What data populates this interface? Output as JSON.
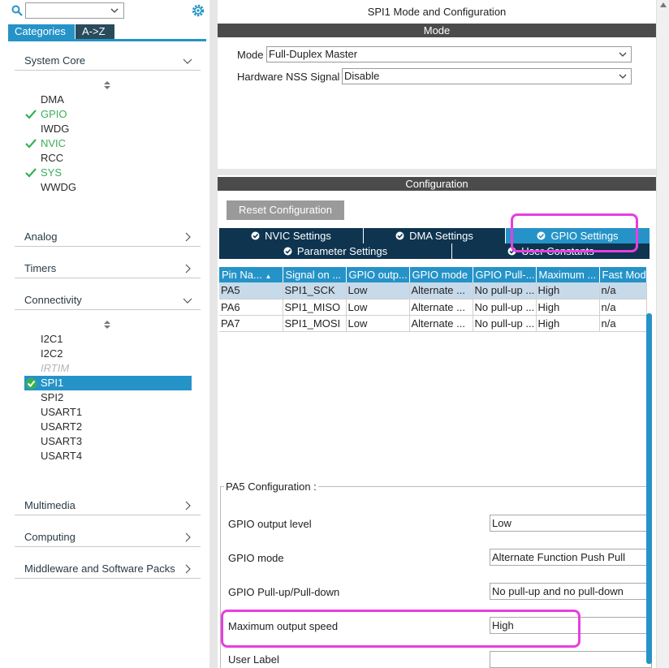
{
  "left": {
    "search": {
      "value": ""
    },
    "tabs": {
      "categories": "Categories",
      "az": "A->Z"
    },
    "sections": {
      "system_core": "System Core",
      "analog": "Analog",
      "timers": "Timers",
      "connectivity": "Connectivity",
      "multimedia": "Multimedia",
      "computing": "Computing",
      "middleware": "Middleware and Software Packs"
    },
    "system_core_items": [
      "DMA",
      "GPIO",
      "IWDG",
      "NVIC",
      "RCC",
      "SYS",
      "WWDG"
    ],
    "connectivity_items": [
      "I2C1",
      "I2C2",
      "IRTIM",
      "SPI1",
      "SPI2",
      "USART1",
      "USART2",
      "USART3",
      "USART4"
    ]
  },
  "right": {
    "title": "SPI1 Mode and Configuration",
    "mode_bar": "Mode",
    "mode_label": "Mode",
    "mode_value": "Full-Duplex Master",
    "nss_label": "Hardware NSS Signal",
    "nss_value": "Disable",
    "config_bar": "Configuration",
    "reset_button": "Reset Configuration",
    "config_tabs": {
      "nvic": "NVIC Settings",
      "dma": "DMA Settings",
      "gpio": "GPIO Settings",
      "params": "Parameter Settings",
      "user_constants": "User Constants"
    },
    "table": {
      "headers": [
        "Pin Na...",
        "Signal on ...",
        "GPIO outp...",
        "GPIO mode",
        "GPIO Pull-...",
        "Maximum ...",
        "Fast Mod"
      ],
      "rows": [
        [
          "PA5",
          "SPI1_SCK",
          "Low",
          "Alternate ...",
          "No pull-up ...",
          "High",
          "n/a"
        ],
        [
          "PA6",
          "SPI1_MISO",
          "Low",
          "Alternate ...",
          "No pull-up ...",
          "High",
          "n/a"
        ],
        [
          "PA7",
          "SPI1_MOSI",
          "Low",
          "Alternate ...",
          "No pull-up ...",
          "High",
          "n/a"
        ]
      ]
    },
    "pin_config": {
      "title": "PA5 Configuration :",
      "fields": [
        {
          "label": "GPIO output level",
          "value": "Low"
        },
        {
          "label": "GPIO mode",
          "value": "Alternate Function Push Pull"
        },
        {
          "label": "GPIO Pull-up/Pull-down",
          "value": "No pull-up and no pull-down"
        },
        {
          "label": "Maximum output speed",
          "value": "High"
        },
        {
          "label": "User Label",
          "value": ""
        }
      ]
    }
  },
  "colors": {
    "accent": "#2593c8",
    "dark_tab": "#0e3450",
    "check_green": "#3aae57",
    "highlight": "#e83ee0"
  }
}
